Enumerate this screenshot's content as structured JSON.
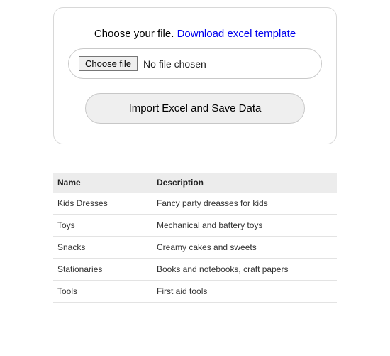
{
  "upload": {
    "prompt_prefix": "Choose your file. ",
    "template_link_text": "Download excel template",
    "choose_button_label": "Choose file",
    "file_status": "No file chosen",
    "import_button_label": "Import Excel and Save Data"
  },
  "table": {
    "headers": {
      "name": "Name",
      "description": "Description"
    },
    "rows": [
      {
        "name": "Kids Dresses",
        "description": "Fancy party dreasses for kids"
      },
      {
        "name": "Toys",
        "description": "Mechanical and battery toys"
      },
      {
        "name": "Snacks",
        "description": "Creamy cakes and sweets"
      },
      {
        "name": "Stationaries",
        "description": "Books and notebooks, craft papers"
      },
      {
        "name": "Tools",
        "description": "First aid tools"
      }
    ]
  }
}
